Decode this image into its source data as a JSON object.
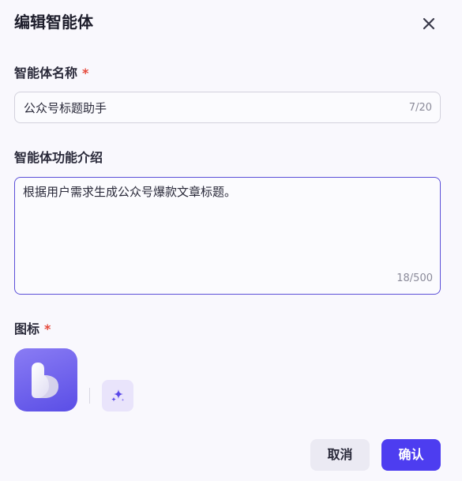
{
  "dialog": {
    "title": "编辑智能体",
    "close_icon": "close-icon"
  },
  "name_field": {
    "label": "智能体名称",
    "required_mark": "*",
    "value": "公众号标题助手",
    "counter": "7/20"
  },
  "description_field": {
    "label": "智能体功能介绍",
    "value": "根据用户需求生成公众号爆款文章标题。",
    "counter": "18/500"
  },
  "icon_field": {
    "label": "图标",
    "required_mark": "*",
    "selected_icon": "b-logo-icon",
    "generate_icon": "sparkle-icon"
  },
  "footer": {
    "cancel_label": "取消",
    "confirm_label": "确认"
  },
  "colors": {
    "accent": "#4d3df0",
    "required": "#e5483a",
    "background": "#f9f8fd"
  }
}
